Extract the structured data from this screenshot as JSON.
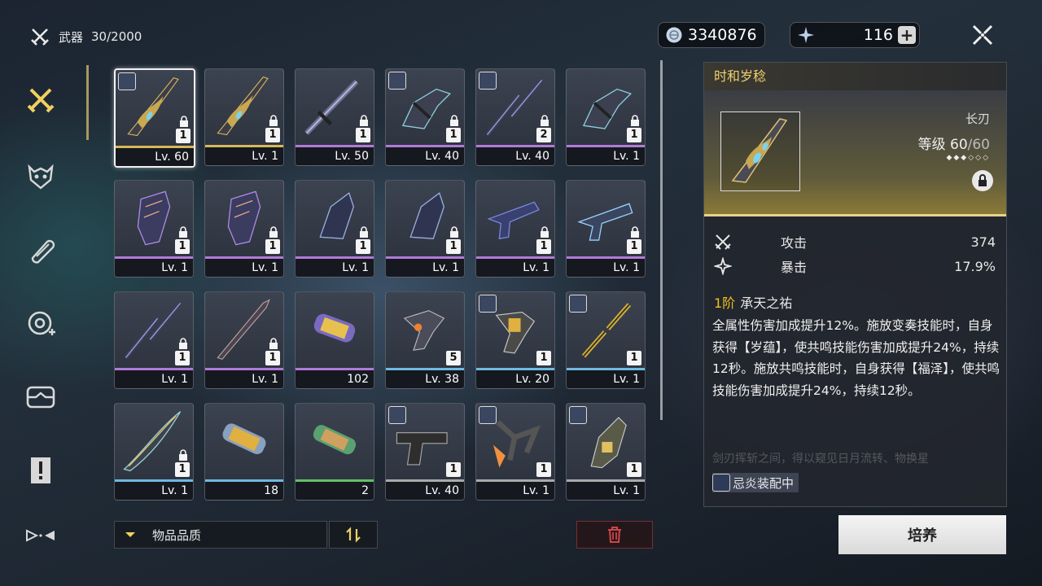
{
  "header": {
    "category_label": "武器",
    "capacity": "30/2000",
    "shell_credits": "3340876",
    "waveplates": "116",
    "plus_label": "+"
  },
  "sidebar": {
    "items": [
      {
        "name": "weapon",
        "icon": "crossed-swords-icon",
        "active": true
      },
      {
        "name": "echo",
        "icon": "echo-mask-icon",
        "active": false
      },
      {
        "name": "dev-materials",
        "icon": "material-icon",
        "active": false
      },
      {
        "name": "resources",
        "icon": "resource-icon",
        "active": false
      },
      {
        "name": "consumables",
        "icon": "box-icon",
        "active": false
      },
      {
        "name": "quest-items",
        "icon": "exclamation-icon",
        "active": false
      },
      {
        "name": "special",
        "icon": "special-icon",
        "active": false
      }
    ]
  },
  "grid": {
    "items": [
      {
        "level": "Lv. 60",
        "count": "1",
        "rarity": "#d6b85a",
        "lock": true,
        "avatar": true,
        "selected": true,
        "kind": "blade"
      },
      {
        "level": "Lv. 1",
        "count": "1",
        "rarity": "#d6b85a",
        "lock": true,
        "avatar": false,
        "kind": "blade"
      },
      {
        "level": "Lv. 50",
        "count": "1",
        "rarity": "#b07ad8",
        "lock": true,
        "avatar": false,
        "kind": "sword"
      },
      {
        "level": "Lv. 40",
        "count": "1",
        "rarity": "#b07ad8",
        "lock": true,
        "avatar": true,
        "kind": "gauntlet"
      },
      {
        "level": "Lv. 40",
        "count": "2",
        "rarity": "#b07ad8",
        "lock": true,
        "avatar": true,
        "kind": "staff"
      },
      {
        "level": "Lv. 1",
        "count": "1",
        "rarity": "#b07ad8",
        "lock": true,
        "avatar": false,
        "kind": "gauntlet"
      },
      {
        "level": "Lv. 1",
        "count": "1",
        "rarity": "#b07ad8",
        "lock": true,
        "avatar": false,
        "kind": "rectifier"
      },
      {
        "level": "Lv. 1",
        "count": "1",
        "rarity": "#b07ad8",
        "lock": true,
        "avatar": false,
        "kind": "rectifier"
      },
      {
        "level": "Lv. 1",
        "count": "1",
        "rarity": "#b07ad8",
        "lock": true,
        "avatar": false,
        "kind": "rectifier2"
      },
      {
        "level": "Lv. 1",
        "count": "1",
        "rarity": "#b07ad8",
        "lock": true,
        "avatar": false,
        "kind": "rectifier2"
      },
      {
        "level": "Lv. 1",
        "count": "1",
        "rarity": "#b07ad8",
        "lock": true,
        "avatar": false,
        "kind": "pistol"
      },
      {
        "level": "Lv. 1",
        "count": "1",
        "rarity": "#b07ad8",
        "lock": true,
        "avatar": false,
        "kind": "pistol2"
      },
      {
        "level": "Lv. 1",
        "count": "1",
        "rarity": "#b07ad8",
        "lock": true,
        "avatar": false,
        "kind": "staff"
      },
      {
        "level": "Lv. 1",
        "count": "1",
        "rarity": "#b07ad8",
        "lock": true,
        "avatar": false,
        "kind": "sword2"
      },
      {
        "level": "102",
        "count": "",
        "rarity": "#b07ad8",
        "lock": false,
        "avatar": false,
        "kind": "capsule-purple"
      },
      {
        "level": "Lv. 38",
        "count": "5",
        "rarity": "#6fb9e0",
        "lock": false,
        "avatar": false,
        "kind": "gauntlet2"
      },
      {
        "level": "Lv. 20",
        "count": "1",
        "rarity": "#6fb9e0",
        "lock": false,
        "avatar": true,
        "kind": "gauntlet3"
      },
      {
        "level": "Lv. 1",
        "count": "1",
        "rarity": "#6fb9e0",
        "lock": false,
        "avatar": true,
        "kind": "nunchaku"
      },
      {
        "level": "Lv. 1",
        "count": "1",
        "rarity": "#6fb9e0",
        "lock": true,
        "avatar": false,
        "kind": "blade2"
      },
      {
        "level": "18",
        "count": "",
        "rarity": "#6fb9e0",
        "lock": false,
        "avatar": false,
        "kind": "capsule-gold"
      },
      {
        "level": "2",
        "count": "",
        "rarity": "#63c06a",
        "lock": false,
        "avatar": false,
        "kind": "capsule-green"
      },
      {
        "level": "Lv. 40",
        "count": "1",
        "rarity": "#aaaaaa",
        "lock": false,
        "avatar": true,
        "kind": "pistol3"
      },
      {
        "level": "Lv. 1",
        "count": "1",
        "rarity": "#aaaaaa",
        "lock": false,
        "avatar": true,
        "kind": "gauntlet4"
      },
      {
        "level": "Lv. 1",
        "count": "1",
        "rarity": "#aaaaaa",
        "lock": false,
        "avatar": true,
        "kind": "rectifier3"
      }
    ]
  },
  "footer": {
    "sort_label": "物品品质",
    "cultivate_label": "培养"
  },
  "detail": {
    "name": "时和岁稔",
    "weapon_type": "长刃",
    "level_label": "等级",
    "level_current": "60",
    "level_max": "/60",
    "rank_dots": "◆◆◆◇◇◇",
    "stats": [
      {
        "label": "攻击",
        "value": "374",
        "icon": "attack-icon"
      },
      {
        "label": "暴击",
        "value": "17.9%",
        "icon": "crit-icon"
      }
    ],
    "skill_rank": "1阶",
    "skill_name": "承天之祐",
    "skill_desc": "全属性伤害加成提升12%。施放变奏技能时，自身获得【岁蕴】，使共鸣技能伤害加成提升24%，持续12秒。施放共鸣技能时，自身获得【福泽】，使共鸣技能伤害加成提升24%，持续12秒。",
    "flavor": "剑刃挥斩之间，得以窥见日月流转、物换星",
    "equipped_by": "忌炎装配中"
  },
  "colors": {
    "accent_gold": "#f0d070",
    "rank_yellow": "#f0c020",
    "trash_red": "#d04545"
  }
}
